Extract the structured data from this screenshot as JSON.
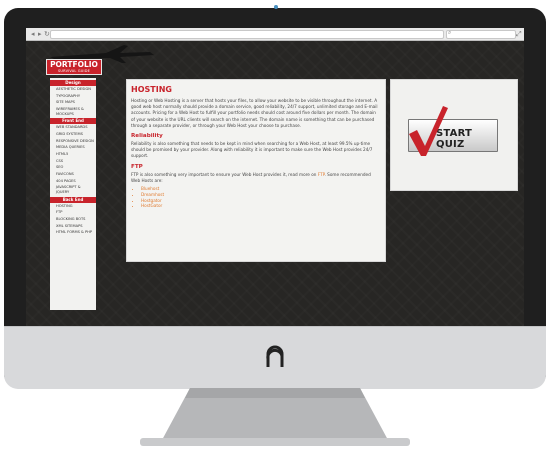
{
  "brand": {
    "title": "PORTFOLIO",
    "subtitle": "SURVIVAL GUIDE"
  },
  "sidebar": {
    "sections": [
      {
        "heading": "Design",
        "items": [
          "AESTHETIC DESIGN",
          "TYPOGRAPHY",
          "SITE MAPS",
          "WIREFRAMES & MOCKUPS"
        ]
      },
      {
        "heading": "Front End",
        "items": [
          "WEB STANDARDS",
          "GRID SYSTEMS",
          "RESPONSIVE DESIGN",
          "MEDIA QUERIES",
          "HTML5",
          "CSS",
          "SEO",
          "FAVICONS",
          "404 PAGES",
          "JAVASCRIPT & JQUERY"
        ]
      },
      {
        "heading": "Back End",
        "items": [
          "HOSTING",
          "FTP",
          "BLOCKING BOTS",
          "XML SITEMAPS",
          "HTML FORMS & PHP"
        ]
      }
    ]
  },
  "content": {
    "title": "HOSTING",
    "intro": "Hosting or Web Hosting is a server that hosts your files, to allow your website to be visible throughout the internet. A good web host normally should provide a domain service, good reliability, 24/7 support, unlimited storage and E-mail accounts. Pricing for a Web Host to fulfill your portfolio needs should cost around five dollars per month. The domain of your website is the URL clients will search on the internet. The domain name is something that can be purchased through a separate provider, or through your Web Host your choose to purchase.",
    "reliability_heading": "Reliability",
    "reliability_text": "Reliability is also something that needs to be kept in mind when searching for a Web Host, at least 99.5% up-time should be promised by your provider. Along with reliability it is important to make sure the Web Host provides 24/7 support.",
    "ftp_heading": "FTP",
    "ftp_text_before": "FTP is also something very important to ensure your Web Host provides it, read more on ",
    "ftp_link": "FTP",
    "ftp_text_after": ". Some recommended Web Hosts are:",
    "hosts": [
      "Bluehost",
      "Dreamhost",
      "Hostgator",
      "HostGator"
    ]
  },
  "quiz": {
    "label": "START QUIZ"
  },
  "colors": {
    "brand_red": "#c8232b",
    "link_orange": "#e07a2e"
  }
}
